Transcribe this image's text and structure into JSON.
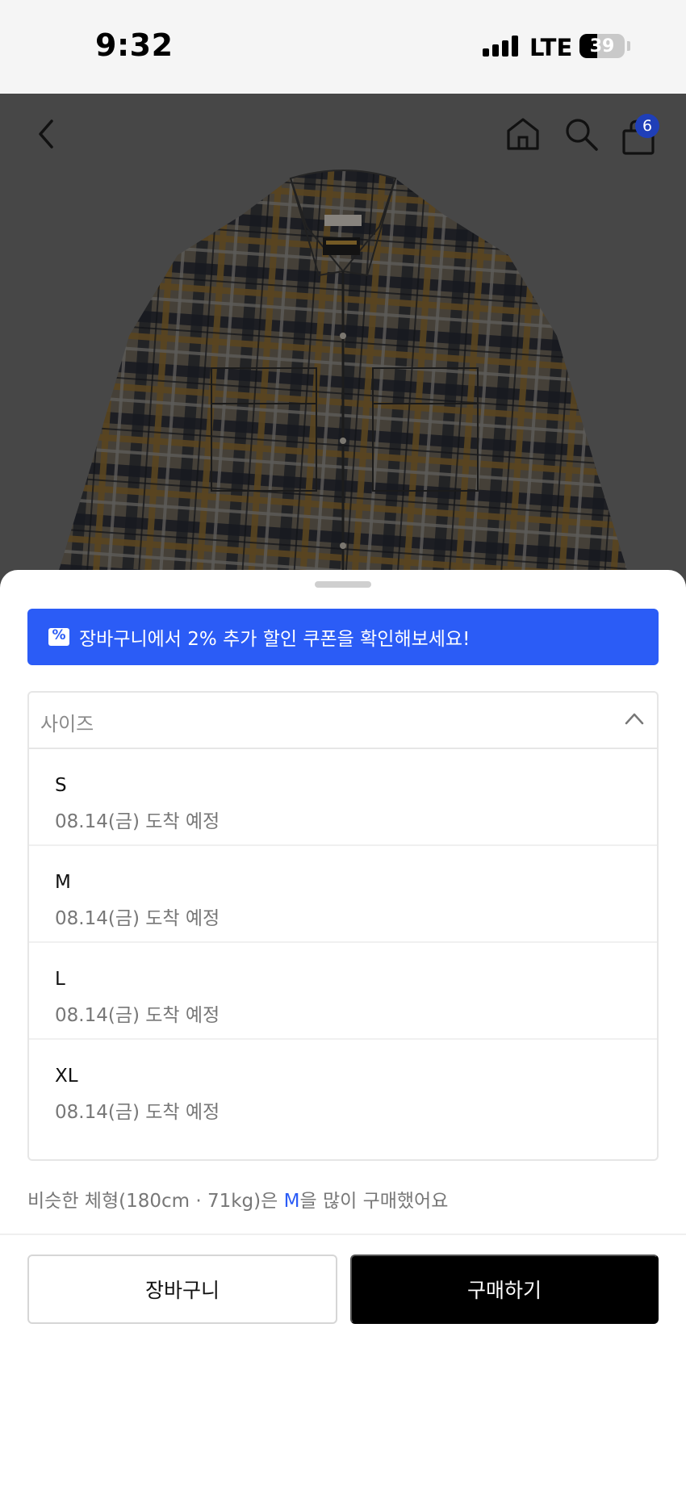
{
  "status_bar": {
    "time": "9:32",
    "network": "LTE",
    "battery_level": "39",
    "battery_fraction": 0.39
  },
  "header": {
    "back_icon": "chevron-left-icon",
    "home_icon": "home-icon",
    "search_icon": "search-icon",
    "cart_icon": "shopping-bag-icon",
    "cart_count": "6"
  },
  "coupon_banner": {
    "icon": "coupon-icon",
    "text": "장바구니에서 2% 추가 할인 쿠폰을 확인해보세요!",
    "color": "#2b5cf6"
  },
  "size_selector": {
    "label": "사이즈",
    "expanded": true,
    "options": [
      {
        "name": "S",
        "delivery": "08.14(금) 도착 예정"
      },
      {
        "name": "M",
        "delivery": "08.14(금) 도착 예정"
      },
      {
        "name": "L",
        "delivery": "08.14(금) 도착 예정"
      },
      {
        "name": "XL",
        "delivery": "08.14(금) 도착 예정"
      }
    ]
  },
  "recommendation": {
    "prefix": "비슷한 체형(180cm · 71kg)은 ",
    "size": "M",
    "suffix": "을 많이 구매했어요"
  },
  "actions": {
    "cart_label": "장바구니",
    "buy_label": "구매하기"
  }
}
